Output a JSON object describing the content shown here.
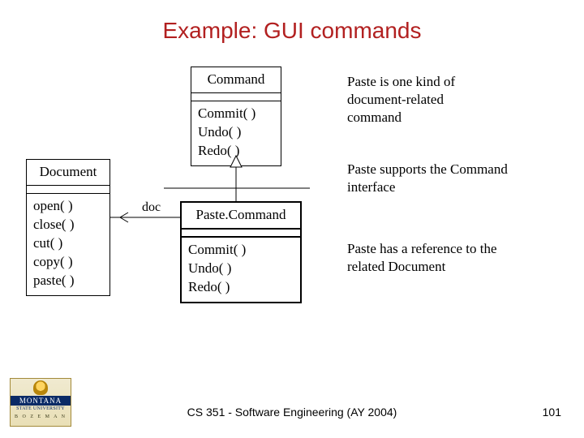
{
  "title": "Example: GUI commands",
  "classes": {
    "command": {
      "name": "Command",
      "ops": [
        "Commit( )",
        "Undo( )",
        "Redo( )"
      ]
    },
    "document": {
      "name": "Document",
      "ops": [
        "open( )",
        "close( )",
        "cut( )",
        "copy( )",
        "paste( )"
      ]
    },
    "paste": {
      "name": "Paste.Command",
      "ops": [
        "Commit( )",
        "Undo( )",
        "Redo( )"
      ]
    }
  },
  "assoc": {
    "doc_label": "doc"
  },
  "notes": {
    "n1": "Paste is one kind of document-related command",
    "n2": "Paste supports the Command interface",
    "n3": "Paste has a reference to the related Document"
  },
  "logo": {
    "name": "MONTANA",
    "sub": "STATE UNIVERSITY",
    "city": "B O Z E M A N"
  },
  "footer": {
    "course": "CS 351 - Software Engineering (AY 2004)",
    "page": "101"
  }
}
